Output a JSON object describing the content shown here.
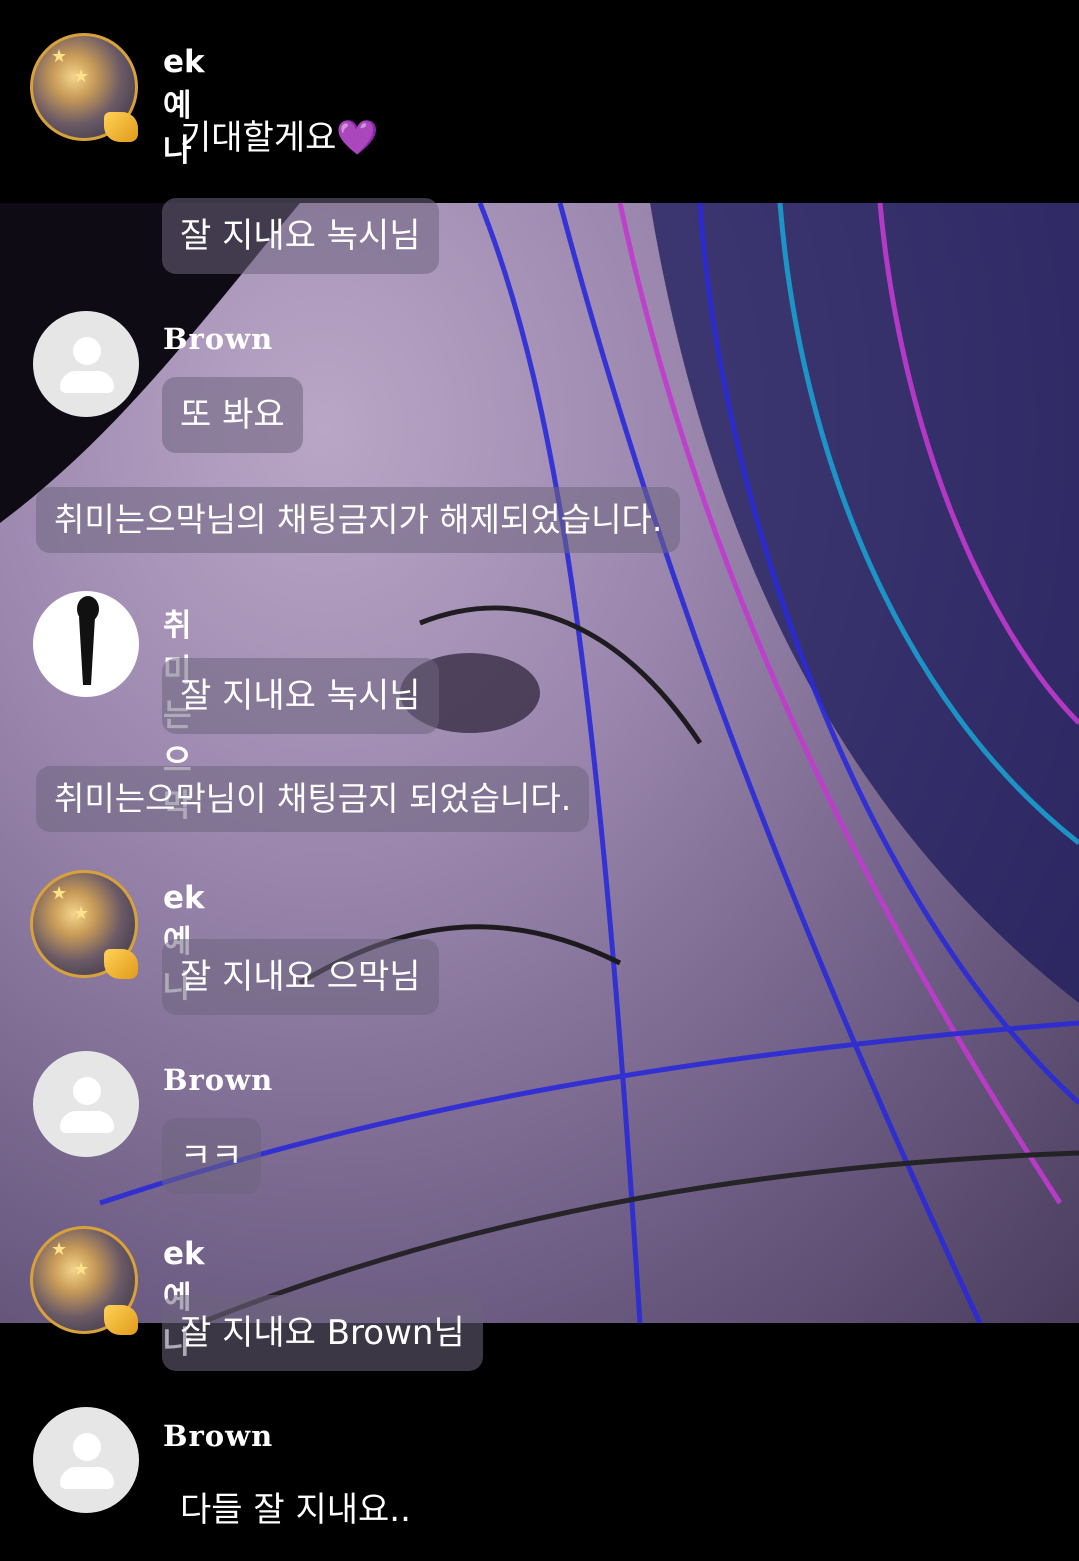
{
  "messages": [
    {
      "user": "ek예나",
      "text": "기대할게요💜"
    },
    {
      "text": "잘 지내요 녹시님"
    },
    {
      "user": "Brown",
      "text": "또 봐요"
    },
    {
      "system": "취미는으막님의 채팅금지가 해제되었습니다."
    },
    {
      "user": "취미는으막",
      "text": "잘 지내요 녹시님"
    },
    {
      "system": "취미는으막님이 채팅금지 되었습니다."
    },
    {
      "user": "ek예나",
      "text": "잘 지내요 으막님"
    },
    {
      "user": "Brown",
      "text": "ㅋㅋ"
    },
    {
      "user": "ek예나",
      "text": "잘 지내요 Brown님"
    },
    {
      "user": "Brown",
      "text": "다들 잘 지내요.."
    }
  ],
  "colors": {
    "avatar_ring": "#d8a23a",
    "bubble": "rgba(110,100,125,0.55)"
  }
}
